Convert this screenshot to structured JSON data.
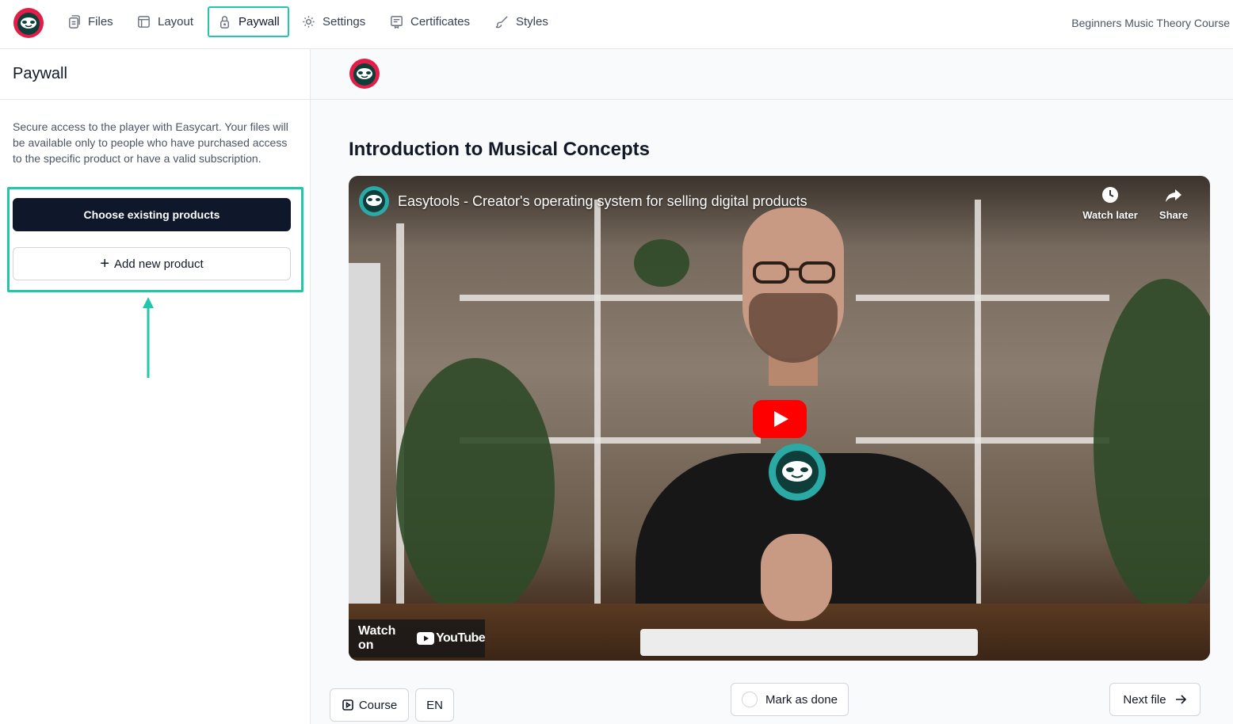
{
  "topbar": {
    "nav": [
      {
        "label": "Files",
        "icon": "files-icon"
      },
      {
        "label": "Layout",
        "icon": "layout-icon"
      },
      {
        "label": "Paywall",
        "icon": "lock-icon",
        "active": true
      },
      {
        "label": "Settings",
        "icon": "gear-icon"
      },
      {
        "label": "Certificates",
        "icon": "certificate-icon"
      },
      {
        "label": "Styles",
        "icon": "brush-icon"
      }
    ],
    "course_title": "Beginners Music Theory Course"
  },
  "sidebar": {
    "title": "Paywall",
    "description": "Secure access to the player with Easycart. Your files will be available only to people who have purchased access to the specific product or have a valid subscription.",
    "choose_button": "Choose existing products",
    "add_button": "Add new product",
    "add_icon": "+"
  },
  "main": {
    "lesson_title": "Introduction to Musical Concepts",
    "video": {
      "title": "Easytools - Creator's operating system for selling digital products",
      "watch_later": "Watch later",
      "share": "Share",
      "watch_on": "Watch on",
      "youtube": "YouTube"
    },
    "footer": {
      "course_button": "Course",
      "language_button": "EN",
      "mark_done": "Mark as done",
      "next_file": "Next file"
    }
  },
  "colors": {
    "accent": "#22c7a9",
    "dark_button": "#0f172a",
    "brand_red": "#e11d48",
    "youtube_red": "#ff0000"
  }
}
